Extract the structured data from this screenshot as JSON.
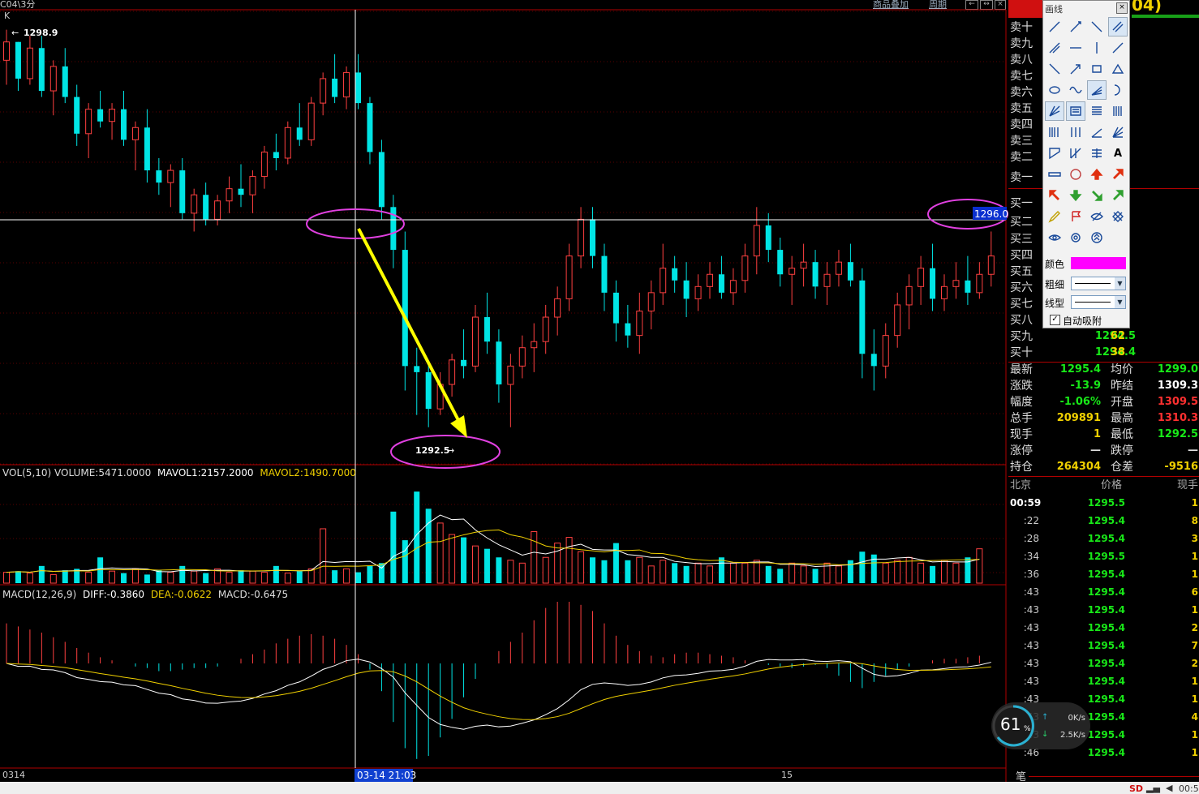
{
  "window": {
    "title": "C04\\3分",
    "period_link": "周期",
    "goods_link": "商品叠加",
    "header_right": "04)",
    "k_label": "K"
  },
  "chart": {
    "high_label": "1298.9",
    "low_label": "1292.5",
    "cursor_price": "1296.0",
    "volume_header": {
      "base": "VOL(5,10) VOLUME:5471.0000",
      "mavol1": "MAVOL1:2157.2000",
      "mavol2": "MAVOL2:1490.7000"
    },
    "macd_header": {
      "base": "MACD(12,26,9)",
      "diff": "DIFF:-0.3860",
      "dea": "DEA:-0.0622",
      "macd": "MACD:-0.6475"
    },
    "x_axis": {
      "left": "0314",
      "cursor": "03-14 21:03",
      "mid": "15"
    },
    "colors": {
      "up": "#ff4040",
      "down": "#00e5e5",
      "cursor": "#ffffff",
      "arrow": "#ffff00",
      "circle": "#e040e0"
    }
  },
  "chart_data": {
    "type": "candlestick",
    "title": "",
    "ylim": [
      1292.0,
      1299.4
    ],
    "cursor_price": 1296.0,
    "high": 1298.9,
    "low": 1292.5,
    "ohlc": [
      [
        1298.6,
        1299.1,
        1298.2,
        1298.9
      ],
      [
        1298.9,
        1298.9,
        1298.1,
        1298.3
      ],
      [
        1298.3,
        1299.0,
        1298.2,
        1298.8
      ],
      [
        1298.8,
        1299.0,
        1298.0,
        1298.1
      ],
      [
        1298.1,
        1298.6,
        1297.7,
        1298.5
      ],
      [
        1298.5,
        1298.8,
        1297.9,
        1298.0
      ],
      [
        1298.0,
        1298.2,
        1297.2,
        1297.4
      ],
      [
        1297.4,
        1297.9,
        1297.0,
        1297.8
      ],
      [
        1297.8,
        1298.1,
        1297.5,
        1297.6
      ],
      [
        1297.6,
        1297.9,
        1297.3,
        1297.8
      ],
      [
        1297.8,
        1298.1,
        1297.2,
        1297.3
      ],
      [
        1297.3,
        1297.6,
        1296.8,
        1297.5
      ],
      [
        1297.5,
        1297.8,
        1296.6,
        1296.8
      ],
      [
        1296.8,
        1297.0,
        1296.4,
        1296.6
      ],
      [
        1296.6,
        1296.9,
        1296.2,
        1296.8
      ],
      [
        1296.8,
        1297.0,
        1296.0,
        1296.1
      ],
      [
        1296.1,
        1296.5,
        1295.8,
        1296.4
      ],
      [
        1296.4,
        1296.6,
        1295.9,
        1296.0
      ],
      [
        1296.0,
        1296.4,
        1295.9,
        1296.3
      ],
      [
        1296.3,
        1296.7,
        1296.1,
        1296.5
      ],
      [
        1296.5,
        1296.9,
        1296.2,
        1296.4
      ],
      [
        1296.4,
        1296.8,
        1296.1,
        1296.7
      ],
      [
        1296.7,
        1297.2,
        1296.5,
        1297.1
      ],
      [
        1297.1,
        1297.4,
        1296.8,
        1297.0
      ],
      [
        1297.0,
        1297.6,
        1296.9,
        1297.5
      ],
      [
        1297.5,
        1297.9,
        1297.2,
        1297.3
      ],
      [
        1297.3,
        1298.0,
        1297.2,
        1297.9
      ],
      [
        1297.9,
        1298.4,
        1297.7,
        1298.3
      ],
      [
        1298.3,
        1298.7,
        1297.9,
        1298.0
      ],
      [
        1298.0,
        1298.5,
        1297.8,
        1298.4
      ],
      [
        1298.4,
        1298.7,
        1297.8,
        1297.9
      ],
      [
        1297.9,
        1298.0,
        1296.9,
        1297.1
      ],
      [
        1297.1,
        1297.3,
        1296.0,
        1296.2
      ],
      [
        1296.2,
        1296.4,
        1295.2,
        1295.5
      ],
      [
        1295.5,
        1295.8,
        1293.2,
        1293.6
      ],
      [
        1293.6,
        1293.9,
        1292.8,
        1293.5
      ],
      [
        1293.5,
        1293.6,
        1292.6,
        1292.9
      ],
      [
        1292.9,
        1293.5,
        1292.8,
        1293.3
      ],
      [
        1293.3,
        1293.8,
        1293.1,
        1293.7
      ],
      [
        1293.7,
        1294.2,
        1293.4,
        1293.6
      ],
      [
        1293.6,
        1294.6,
        1293.5,
        1294.4
      ],
      [
        1294.4,
        1294.8,
        1293.8,
        1294.0
      ],
      [
        1294.0,
        1294.2,
        1293.0,
        1293.3
      ],
      [
        1293.3,
        1293.8,
        1292.6,
        1293.6
      ],
      [
        1293.6,
        1294.1,
        1293.4,
        1293.9
      ],
      [
        1293.9,
        1294.3,
        1293.5,
        1294.0
      ],
      [
        1294.0,
        1294.6,
        1293.8,
        1294.4
      ],
      [
        1294.4,
        1294.9,
        1294.1,
        1294.7
      ],
      [
        1294.7,
        1295.6,
        1294.5,
        1295.4
      ],
      [
        1295.4,
        1296.2,
        1295.2,
        1296.0
      ],
      [
        1296.0,
        1296.2,
        1295.2,
        1295.4
      ],
      [
        1295.4,
        1295.6,
        1294.5,
        1294.8
      ],
      [
        1294.8,
        1295.0,
        1294.0,
        1294.3
      ],
      [
        1294.3,
        1294.6,
        1293.9,
        1294.1
      ],
      [
        1294.1,
        1294.8,
        1293.8,
        1294.5
      ],
      [
        1294.5,
        1295.0,
        1294.2,
        1294.8
      ],
      [
        1294.8,
        1295.6,
        1294.6,
        1295.2
      ],
      [
        1295.2,
        1295.4,
        1294.8,
        1295.0
      ],
      [
        1295.0,
        1295.3,
        1294.4,
        1294.7
      ],
      [
        1294.7,
        1295.1,
        1294.5,
        1294.9
      ],
      [
        1294.9,
        1295.3,
        1294.7,
        1295.1
      ],
      [
        1295.1,
        1295.4,
        1294.7,
        1294.8
      ],
      [
        1294.8,
        1295.2,
        1294.6,
        1295.0
      ],
      [
        1295.0,
        1295.6,
        1294.8,
        1295.4
      ],
      [
        1295.4,
        1296.2,
        1295.1,
        1295.9
      ],
      [
        1295.9,
        1296.1,
        1295.3,
        1295.5
      ],
      [
        1295.5,
        1295.7,
        1294.9,
        1295.1
      ],
      [
        1295.1,
        1295.4,
        1294.6,
        1295.2
      ],
      [
        1295.2,
        1295.6,
        1294.9,
        1295.3
      ],
      [
        1295.3,
        1295.5,
        1294.7,
        1294.9
      ],
      [
        1294.9,
        1295.3,
        1294.6,
        1295.1
      ],
      [
        1295.1,
        1295.5,
        1294.9,
        1295.3
      ],
      [
        1295.3,
        1295.6,
        1294.9,
        1295.0
      ],
      [
        1295.0,
        1295.2,
        1293.4,
        1293.8
      ],
      [
        1293.8,
        1294.2,
        1293.2,
        1293.6
      ],
      [
        1293.6,
        1294.3,
        1293.4,
        1294.1
      ],
      [
        1294.1,
        1294.8,
        1293.9,
        1294.6
      ],
      [
        1294.6,
        1295.1,
        1294.2,
        1294.9
      ],
      [
        1294.9,
        1295.4,
        1294.6,
        1295.2
      ],
      [
        1295.2,
        1295.6,
        1294.5,
        1294.7
      ],
      [
        1294.7,
        1295.1,
        1294.5,
        1294.9
      ],
      [
        1294.9,
        1295.3,
        1294.7,
        1295.0
      ],
      [
        1295.0,
        1295.4,
        1294.6,
        1294.8
      ],
      [
        1294.8,
        1295.3,
        1294.7,
        1295.1
      ],
      [
        1295.1,
        1295.8,
        1294.9,
        1295.4
      ]
    ],
    "volume": [
      380,
      420,
      350,
      600,
      300,
      450,
      500,
      380,
      900,
      420,
      350,
      500,
      300,
      450,
      380,
      600,
      420,
      350,
      500,
      380,
      450,
      420,
      380,
      600,
      350,
      420,
      500,
      1900,
      450,
      500,
      380,
      600,
      700,
      2500,
      1500,
      3200,
      2600,
      2100,
      1700,
      1600,
      1300,
      1200,
      900,
      800,
      700,
      1800,
      900,
      1400,
      1600,
      1100,
      900,
      800,
      1400,
      800,
      900,
      600,
      800,
      700,
      600,
      700,
      600,
      900,
      700,
      700,
      800,
      600,
      500,
      700,
      600,
      500,
      700,
      600,
      800,
      1100,
      1000,
      700,
      800,
      900,
      700,
      600,
      800,
      700,
      900,
      1200
    ],
    "macd_hist": [
      0.26,
      0.24,
      0.22,
      0.2,
      0.17,
      0.14,
      0.1,
      0.07,
      0.04,
      0.02,
      0.0,
      -0.02,
      -0.03,
      -0.05,
      -0.05,
      -0.04,
      -0.03,
      -0.03,
      -0.02,
      0.0,
      0.03,
      0.06,
      0.09,
      0.13,
      0.16,
      0.18,
      0.19,
      0.18,
      0.16,
      0.12,
      0.06,
      -0.04,
      -0.18,
      -0.38,
      -0.55,
      -0.62,
      -0.6,
      -0.48,
      -0.36,
      -0.22,
      -0.1,
      0.0,
      0.08,
      0.14,
      0.2,
      0.28,
      0.36,
      0.4,
      0.4,
      0.38,
      0.34,
      0.26,
      0.18,
      0.12,
      0.08,
      0.05,
      0.04,
      0.06,
      0.07,
      0.07,
      0.06,
      0.05,
      0.04,
      0.02,
      0.0,
      -0.01,
      -0.02,
      -0.03,
      -0.02,
      -0.01,
      -0.03,
      -0.08,
      -0.12,
      -0.16,
      -0.12,
      -0.08,
      -0.04,
      -0.02,
      0.0,
      0.02,
      0.03,
      0.03,
      0.04,
      0.05
    ]
  },
  "order_book": {
    "asks": [
      {
        "label": "卖十"
      },
      {
        "label": "卖九"
      },
      {
        "label": "卖八"
      },
      {
        "label": "卖七"
      },
      {
        "label": "卖六"
      },
      {
        "label": "卖五"
      },
      {
        "label": "卖四"
      },
      {
        "label": "卖三"
      },
      {
        "label": "卖二"
      },
      {
        "label": "卖一"
      }
    ],
    "bids": [
      {
        "label": "买一",
        "price": "",
        "vol": ""
      },
      {
        "label": "买二",
        "price": "",
        "vol": ""
      },
      {
        "label": "买三",
        "price": "",
        "vol": ""
      },
      {
        "label": "买四",
        "price": "",
        "vol": ""
      },
      {
        "label": "买五",
        "price": "",
        "vol": ""
      },
      {
        "label": "买六",
        "price": "",
        "vol": ""
      },
      {
        "label": "买七",
        "price": "",
        "vol": ""
      },
      {
        "label": "买八",
        "price": "",
        "vol": ""
      },
      {
        "label": "买九",
        "price": "1294.5",
        "vol": "62"
      },
      {
        "label": "买十",
        "price": "1294.4",
        "vol": "38"
      }
    ]
  },
  "quote": [
    {
      "l1": "最新",
      "v1": "1295.4",
      "c1": "#18e818",
      "l2": "均价",
      "v2": "1299.0",
      "c2": "#18e818"
    },
    {
      "l1": "涨跌",
      "v1": "-13.9",
      "c1": "#18e818",
      "l2": "昨结",
      "v2": "1309.3",
      "c2": "#ffffff"
    },
    {
      "l1": "幅度",
      "v1": "-1.06%",
      "c1": "#18e818",
      "l2": "开盘",
      "v2": "1309.5",
      "c2": "#ff3030"
    },
    {
      "l1": "总手",
      "v1": "209891",
      "c1": "#f0d000",
      "l2": "最高",
      "v2": "1310.3",
      "c2": "#ff3030"
    },
    {
      "l1": "现手",
      "v1": "1",
      "c1": "#f0d000",
      "l2": "最低",
      "v2": "1292.5",
      "c2": "#18e818"
    },
    {
      "l1": "涨停",
      "v1": "—",
      "c1": "#dddddd",
      "l2": "跌停",
      "v2": "—",
      "c2": "#dddddd"
    },
    {
      "l1": "持仓",
      "v1": "264304",
      "c1": "#f0d000",
      "l2": "仓差",
      "v2": "-9516",
      "c2": "#f0d000"
    }
  ],
  "ticks": {
    "headers": {
      "time": "北京",
      "price": "价格",
      "vol": "现手"
    },
    "rows": [
      {
        "time": "00:59",
        "price": "1295.5",
        "vol": "1"
      },
      {
        "time": ":22",
        "price": "1295.4",
        "vol": "8"
      },
      {
        "time": ":28",
        "price": "1295.4",
        "vol": "3"
      },
      {
        "time": ":34",
        "price": "1295.5",
        "vol": "1"
      },
      {
        "time": ":36",
        "price": "1295.4",
        "vol": "1"
      },
      {
        "time": ":43",
        "price": "1295.4",
        "vol": "6"
      },
      {
        "time": ":43",
        "price": "1295.4",
        "vol": "1"
      },
      {
        "time": ":43",
        "price": "1295.4",
        "vol": "2"
      },
      {
        "time": ":43",
        "price": "1295.4",
        "vol": "7"
      },
      {
        "time": ":43",
        "price": "1295.4",
        "vol": "2"
      },
      {
        "time": ":43",
        "price": "1295.4",
        "vol": "1"
      },
      {
        "time": ":43",
        "price": "1295.4",
        "vol": "1"
      },
      {
        "time": ":43",
        "price": "1295.4",
        "vol": "4"
      },
      {
        "time": ":43",
        "price": "1295.4",
        "vol": "1"
      },
      {
        "time": ":46",
        "price": "1295.4",
        "vol": "1"
      }
    ],
    "footer_tab": "笔"
  },
  "toolbox": {
    "title": "画线",
    "close": "×",
    "color_label": "颜色",
    "color_value": "#ff00ff",
    "width_label": "粗细",
    "style_label": "线型",
    "autosnap_label": "自动吸附",
    "autosnap_checked": true
  },
  "speed_widget": {
    "percent": "61",
    "percent_unit": "%",
    "up": "0K/s",
    "down": "2.5K/s"
  },
  "statusbar": {
    "time": "00:5",
    "sd": "SD"
  }
}
